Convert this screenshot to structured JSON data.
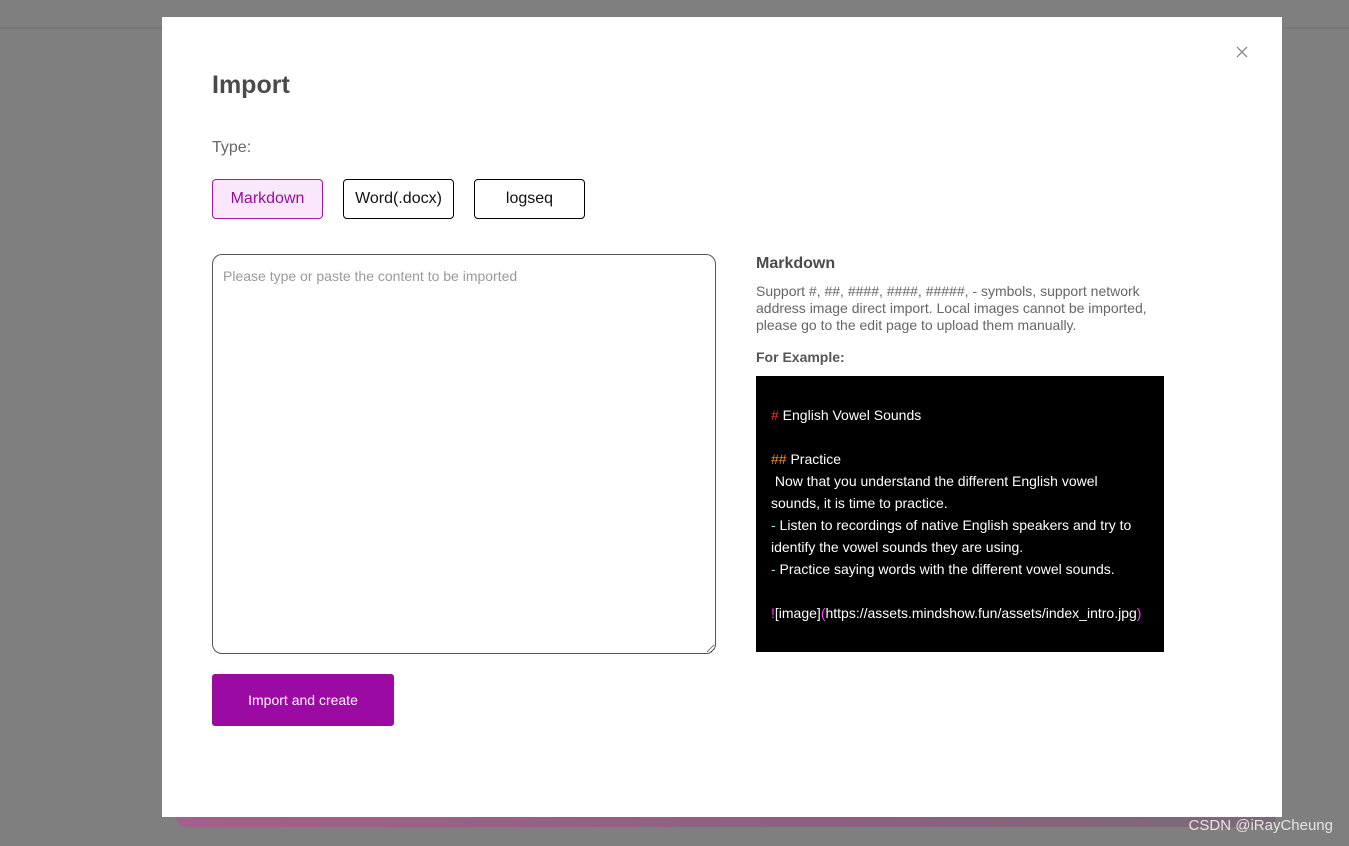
{
  "modal": {
    "title": "Import",
    "type_label": "Type:",
    "types": [
      {
        "label": "Markdown",
        "active": true
      },
      {
        "label": "Word(.docx)",
        "active": false
      },
      {
        "label": "logseq",
        "active": false
      }
    ],
    "content_input": {
      "placeholder": "Please type or paste the content to be imported",
      "value": ""
    },
    "submit_label": "Import and create",
    "close_icon": "close-icon"
  },
  "help": {
    "title": "Markdown",
    "description": "Support #, ##, ####, ####, #####, - symbols, support network address image direct import. Local images cannot be imported, please go to the edit page to upload them manually.",
    "example_label": "For Example:",
    "example": {
      "h1_mark": "#",
      "h1_text": " English Vowel Sounds",
      "h2_mark": "##",
      "h2_text": " Practice",
      "paragraph": " Now that you understand the different English vowel sounds, it is time to practice.",
      "list_mark": "-",
      "item1": " Listen to recordings of native English speakers and try to identify the vowel sounds they are using.",
      "item2": " Practice saying words with the different vowel sounds.",
      "image_bang": "!",
      "image_alt": "[image]",
      "image_paren_open": "(",
      "image_url": "https://assets.mindshow.fun/assets/index_intro.jpg",
      "image_paren_close": ")"
    }
  },
  "watermark": "CSDN @iRayCheung",
  "colors": {
    "accent": "#9b0aa2",
    "active_tab_bg": "#fbe7fb",
    "code_bg": "#000000"
  }
}
